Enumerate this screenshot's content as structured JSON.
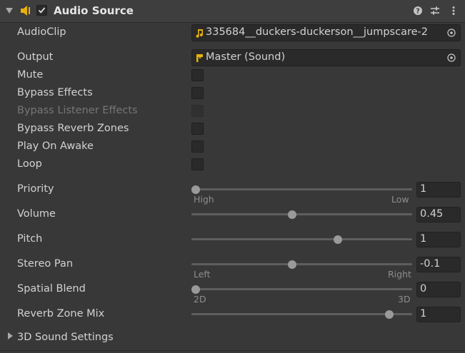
{
  "header": {
    "title": "Audio Source",
    "enabled": true,
    "icons": [
      "foldout-arrow-icon",
      "speaker-icon",
      "help-icon",
      "presets-icon",
      "more-icon"
    ]
  },
  "fields": {
    "audio_clip": {
      "label": "AudioClip",
      "value": "335684__duckers-duckerson__jumpscare-2",
      "icon": "music-note-icon"
    },
    "output": {
      "label": "Output",
      "value": "Master (Sound)",
      "icon": "mixer-group-icon"
    },
    "mute": {
      "label": "Mute",
      "checked": false
    },
    "bypass_effects": {
      "label": "Bypass Effects",
      "checked": false
    },
    "bypass_listener_effects": {
      "label": "Bypass Listener Effects",
      "checked": false,
      "disabled": true
    },
    "bypass_reverb_zones": {
      "label": "Bypass Reverb Zones",
      "checked": false
    },
    "play_on_awake": {
      "label": "Play On Awake",
      "checked": false
    },
    "loop": {
      "label": "Loop",
      "checked": false
    }
  },
  "sliders": {
    "priority": {
      "label": "Priority",
      "value": "1",
      "level": 0.0,
      "min_label": "High",
      "max_label": "Low"
    },
    "volume": {
      "label": "Volume",
      "value": "0.45",
      "level": 0.45
    },
    "pitch": {
      "label": "Pitch",
      "value": "1",
      "level": 0.66
    },
    "stereo_pan": {
      "label": "Stereo Pan",
      "value": "-0.1",
      "level": 0.45,
      "min_label": "Left",
      "max_label": "Right"
    },
    "spatial_blend": {
      "label": "Spatial Blend",
      "value": "0",
      "level": 0.0,
      "min_label": "2D",
      "max_label": "3D"
    },
    "reverb_zone_mix": {
      "label": "Reverb Zone Mix",
      "value": "1",
      "level": 0.9
    }
  },
  "footer": {
    "sound_settings_label": "3D Sound Settings"
  },
  "colors": {
    "background": "#383838",
    "field": "#2a2a2a",
    "accent_icon": "#e8b10c",
    "thumb": "#9a9a9a"
  }
}
